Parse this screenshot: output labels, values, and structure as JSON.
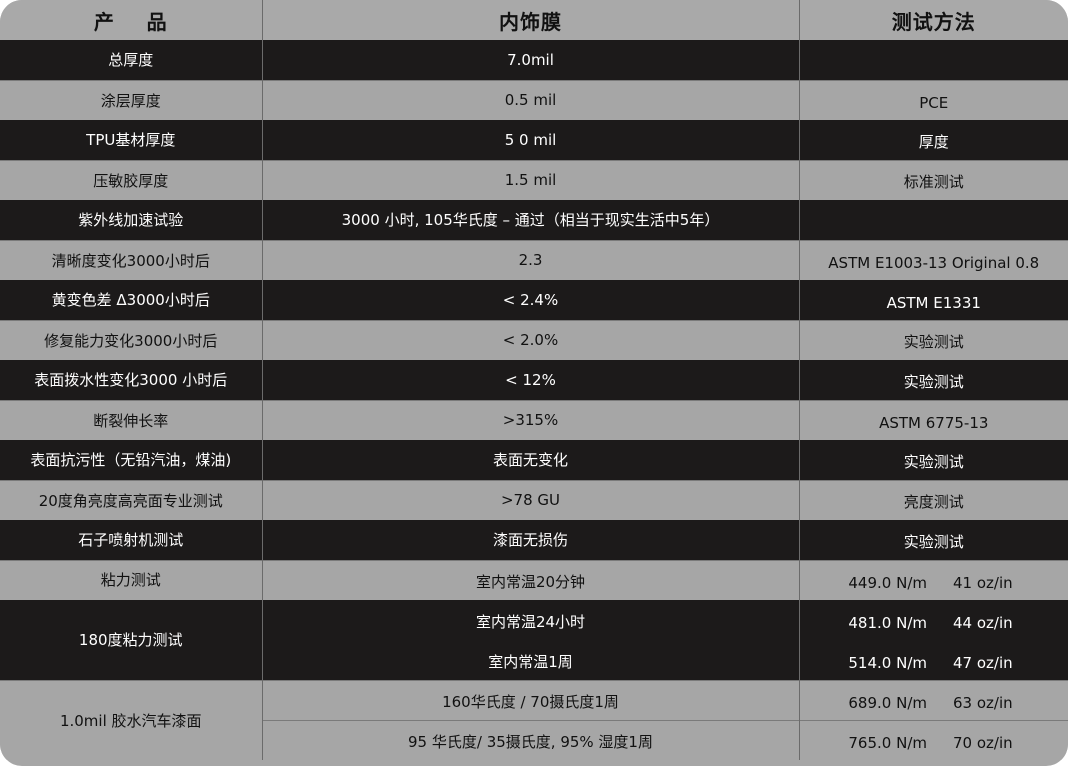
{
  "headers": [
    "产    品",
    "内饰膜",
    "测试方法"
  ],
  "rows": [
    {
      "product": "总厚度",
      "value": "7.0mil",
      "method": ""
    },
    {
      "product": "涂层厚度",
      "value": "0.5 mil",
      "method": "PCE"
    },
    {
      "product": "TPU基材厚度",
      "value": "5 0 mil",
      "method": "厚度"
    },
    {
      "product": "压敏胶厚度",
      "value": "1.5 mil",
      "method": "标准测试"
    },
    {
      "product": "紫外线加速试验",
      "value": "3000 小时, 105华氏度 – 通过（相当于现实生活中5年）",
      "method": ""
    },
    {
      "product": "清晰度变化3000小时后",
      "value": "2.3",
      "method": "ASTM E1003-13 Original 0.8"
    },
    {
      "product": "黄变色差 Δ3000小时后",
      "value": "< 2.4%",
      "method": "ASTM E1331"
    },
    {
      "product": "修复能力变化3000小时后",
      "value": "< 2.0%",
      "method": "实验测试"
    },
    {
      "product": "表面拨水性变化3000 小时后",
      "value": "< 12%",
      "method": "实验测试"
    },
    {
      "product": "断裂伸长率",
      "value": ">315%",
      "method": "ASTM 6775-13"
    },
    {
      "product": "表面抗污性（无铅汽油，煤油)",
      "value": "表面无变化",
      "method": "实验测试"
    },
    {
      "product": "20度角亮度高亮面专业测试",
      "value": ">78 GU",
      "method": "亮度测试"
    },
    {
      "product": "石子喷射机测试",
      "value": "漆面无损伤",
      "method": "实验测试"
    }
  ],
  "adhesion": {
    "row1": {
      "product": "粘力测试",
      "condition": "室内常温20分钟",
      "nm": "449.0 N/m",
      "ozin": "41 oz/in"
    },
    "peel": {
      "product": "180度粘力测试",
      "items": [
        {
          "condition": "室内常温24小时",
          "nm": "481.0 N/m",
          "ozin": "44 oz/in"
        },
        {
          "condition": "室内常温1周",
          "nm": "514.0 N/m",
          "ozin": "47 oz/in"
        }
      ]
    },
    "paint": {
      "product": "1.0mil 胶水汽车漆面",
      "items": [
        {
          "condition": "160华氏度 / 70摄氏度1周",
          "nm": "689.0 N/m",
          "ozin": "63 oz/in"
        },
        {
          "condition": "95 华氏度/ 35摄氏度, 95% 湿度1周",
          "nm": "765.0 N/m",
          "ozin": "70 oz/in"
        }
      ]
    }
  }
}
